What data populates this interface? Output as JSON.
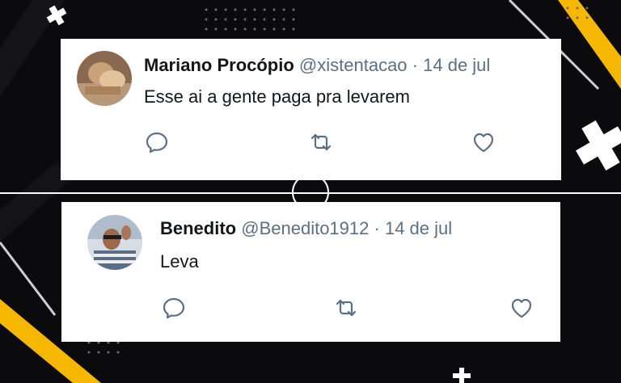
{
  "tweets": [
    {
      "name": "Mariano Procópio",
      "handle": "@xistentacao",
      "separator": "·",
      "date": "14 de jul",
      "text": "Esse ai a gente paga pra levarem",
      "avatar_icon": "person-avatar-icon"
    },
    {
      "name": "Benedito",
      "handle": "@Benedito1912",
      "separator": "·",
      "date": "14 de jul",
      "text": "Leva",
      "avatar_icon": "person-avatar-icon"
    }
  ],
  "colors": {
    "background": "#0b0b0d",
    "accent_yellow": "#f5b700",
    "secondary_text": "#5b7083",
    "primary_text": "#14171a"
  }
}
